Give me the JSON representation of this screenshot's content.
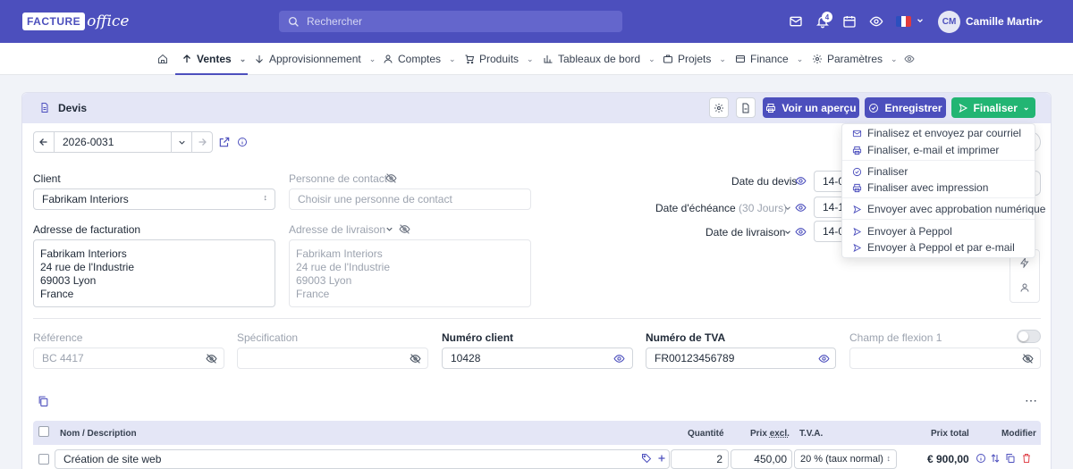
{
  "header": {
    "logo_text": "FACTURE",
    "logo_text2": "office",
    "search_placeholder": "Rechercher",
    "notifications_count": "4",
    "user_initials": "CM",
    "user_name": "Camille Martin",
    "accent": "#4c4fbd"
  },
  "nav": {
    "items": [
      {
        "label": "Ventes",
        "icon": "arrow-up-icon"
      },
      {
        "label": "Approvisionnement",
        "icon": "arrow-down-icon"
      },
      {
        "label": "Comptes",
        "icon": "user-icon"
      },
      {
        "label": "Produits",
        "icon": "cart-icon"
      },
      {
        "label": "Tableaux de bord",
        "icon": "bar-chart-icon"
      },
      {
        "label": "Projets",
        "icon": "briefcase-icon"
      },
      {
        "label": "Finance",
        "icon": "card-icon"
      },
      {
        "label": "Paramètres",
        "icon": "gear-icon"
      }
    ]
  },
  "doc": {
    "title": "Devis",
    "preview_label": "Voir un aperçu",
    "save_label": "Enregistrer",
    "finalize_label": "Finaliser",
    "number": "2026-0031"
  },
  "dropdown": {
    "items": [
      "Finalisez et envoyez par courriel",
      "Finaliser, e-mail et imprimer",
      "Finaliser",
      "Finaliser avec impression",
      "Envoyer avec approbation numérique",
      "Envoyer à Peppol",
      "Envoyer à Peppol et par e-mail"
    ]
  },
  "form": {
    "client_label": "Client",
    "client_value": "Fabrikam Interiors",
    "contact_label": "Personne de contact",
    "contact_placeholder": "Choisir une personne de contact",
    "billing_label": "Adresse de facturation",
    "billing_lines": [
      "Fabrikam Interiors",
      "24 rue de l'Industrie",
      "69003 Lyon",
      "France"
    ],
    "delivery_label": "Adresse de livraison",
    "delivery_lines": [
      "Fabrikam Interiors",
      "24 rue de l'Industrie",
      "69003 Lyon",
      "France"
    ],
    "date_devis_label": "Date du devis",
    "date_devis_value": "14-0",
    "date_echeance_label": "Date d'échéance",
    "date_echeance_hint": "(30 Jours)",
    "date_echeance_value": "14-1",
    "date_livraison_label": "Date de livraison",
    "date_livraison_value": "14-0",
    "reference_label": "Référence",
    "reference_placeholder": "BC 4417",
    "specification_label": "Spécification",
    "numero_client_label": "Numéro client",
    "numero_client_value": "10428",
    "tva_label": "Numéro de TVA",
    "tva_value": "FR00123456789",
    "flex_label": "Champ de flexion 1"
  },
  "table": {
    "headers": {
      "name": "Nom / Description",
      "qty": "Quantité",
      "price": "Prix",
      "price_suffix": "excl.",
      "vat": "T.V.A.",
      "total": "Prix total",
      "edit": "Modifier"
    },
    "rows": [
      {
        "name": "Création de site web",
        "qty": "2",
        "price": "450,00",
        "vat": "20 % (taux normal)",
        "total": "€ 900,00"
      }
    ]
  }
}
